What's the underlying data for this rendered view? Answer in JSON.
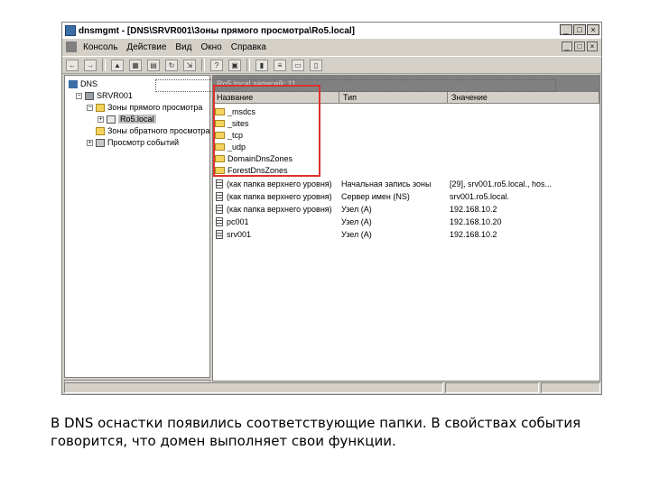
{
  "window": {
    "title": "dnsmgmt - [DNS\\SRVR001\\Зоны прямого просмотра\\Ro5.local]",
    "minimize": "_",
    "maximize": "□",
    "close": "×"
  },
  "menu": [
    "Консоль",
    "Действие",
    "Вид",
    "Окно",
    "Справка"
  ],
  "tree": {
    "root": "DNS",
    "server": "SRVR001",
    "forward": "Зоны прямого просмотра",
    "selected_zone": "Ro5.local",
    "reverse": "Зоны обратного просмотра",
    "events": "Просмотр событий"
  },
  "panel_header": "Ro5.local    записей: 11",
  "columns": [
    "Название",
    "Тип",
    "Значение"
  ],
  "folders": [
    "_msdcs",
    "_sites",
    "_tcp",
    "_udp",
    "DomainDnsZones",
    "ForestDnsZones"
  ],
  "records": [
    {
      "name": "(как папка верхнего уровня)",
      "type": "Начальная запись зоны",
      "value": "[29], srv001.ro5.local., hos..."
    },
    {
      "name": "(как папка верхнего уровня)",
      "type": "Сервер имен (NS)",
      "value": "srv001.ro5.local."
    },
    {
      "name": "(как папка верхнего уровня)",
      "type": "Узел (A)",
      "value": "192.168.10.2"
    },
    {
      "name": "pc001",
      "type": "Узел (A)",
      "value": "192.168.10.20"
    },
    {
      "name": "srv001",
      "type": "Узел (A)",
      "value": "192.168.10.2"
    }
  ],
  "caption": "В DNS оснастки появились соответствующие папки. В свойствах события говорится, что домен выполняет свои функции.",
  "colors": {
    "highlight_box": "#e0302e",
    "folder": "#f4d35e",
    "panel_header_bg": "#808080"
  }
}
